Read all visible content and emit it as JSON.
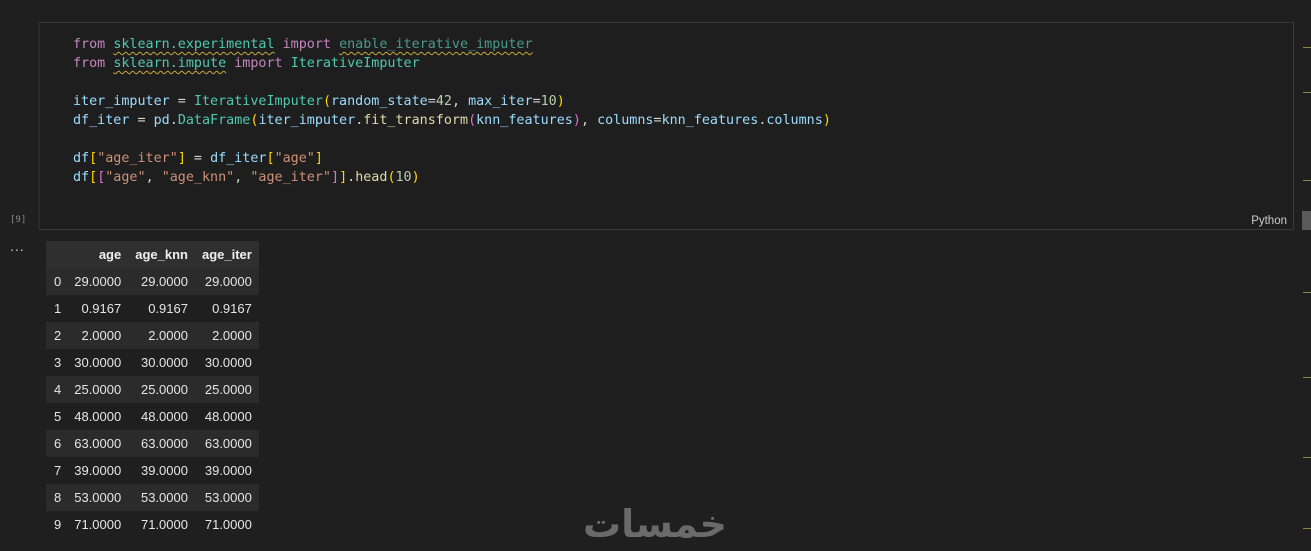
{
  "cell": {
    "execution_count": "[9]",
    "language": "Python",
    "code_lines": [
      [
        [
          "kw",
          "from"
        ],
        [
          "op",
          " "
        ],
        [
          "mod squiggle",
          "sklearn.experimental"
        ],
        [
          "op",
          " "
        ],
        [
          "kw",
          "import"
        ],
        [
          "op",
          " "
        ],
        [
          "faded squiggle",
          "enable_iterative_imputer"
        ]
      ],
      [
        [
          "kw",
          "from"
        ],
        [
          "op",
          " "
        ],
        [
          "mod squiggle",
          "sklearn.impute"
        ],
        [
          "op",
          " "
        ],
        [
          "kw",
          "import"
        ],
        [
          "op",
          " "
        ],
        [
          "mod",
          "IterativeImputer"
        ]
      ],
      [],
      [
        [
          "var",
          "iter_imputer"
        ],
        [
          "op",
          " = "
        ],
        [
          "mod",
          "IterativeImputer"
        ],
        [
          "paren1",
          "("
        ],
        [
          "var",
          "random_state"
        ],
        [
          "op",
          "="
        ],
        [
          "num",
          "42"
        ],
        [
          "op",
          ", "
        ],
        [
          "var",
          "max_iter"
        ],
        [
          "op",
          "="
        ],
        [
          "num",
          "10"
        ],
        [
          "paren1",
          ")"
        ]
      ],
      [
        [
          "var",
          "df_iter"
        ],
        [
          "op",
          " = "
        ],
        [
          "var",
          "pd"
        ],
        [
          "op",
          "."
        ],
        [
          "mod",
          "DataFrame"
        ],
        [
          "paren1",
          "("
        ],
        [
          "var",
          "iter_imputer"
        ],
        [
          "op",
          "."
        ],
        [
          "fn",
          "fit_transform"
        ],
        [
          "paren2",
          "("
        ],
        [
          "var",
          "knn_features"
        ],
        [
          "paren2",
          ")"
        ],
        [
          "op",
          ", "
        ],
        [
          "var",
          "columns"
        ],
        [
          "op",
          "="
        ],
        [
          "var",
          "knn_features"
        ],
        [
          "op",
          "."
        ],
        [
          "var",
          "columns"
        ],
        [
          "paren1",
          ")"
        ]
      ],
      [],
      [
        [
          "var",
          "df"
        ],
        [
          "paren1",
          "["
        ],
        [
          "str",
          "\"age_iter\""
        ],
        [
          "paren1",
          "]"
        ],
        [
          "op",
          " = "
        ],
        [
          "var",
          "df_iter"
        ],
        [
          "paren1",
          "["
        ],
        [
          "str",
          "\"age\""
        ],
        [
          "paren1",
          "]"
        ]
      ],
      [
        [
          "var",
          "df"
        ],
        [
          "paren1",
          "["
        ],
        [
          "paren2",
          "["
        ],
        [
          "str",
          "\"age\""
        ],
        [
          "op",
          ", "
        ],
        [
          "str",
          "\"age_knn\""
        ],
        [
          "op",
          ", "
        ],
        [
          "str",
          "\"age_iter\""
        ],
        [
          "paren2",
          "]"
        ],
        [
          "paren1",
          "]"
        ],
        [
          "op",
          "."
        ],
        [
          "fn",
          "head"
        ],
        [
          "paren1",
          "("
        ],
        [
          "num",
          "10"
        ],
        [
          "paren1",
          ")"
        ]
      ]
    ]
  },
  "output": {
    "menu_label": "...",
    "columns": [
      "",
      "age",
      "age_knn",
      "age_iter"
    ],
    "rows": [
      [
        "0",
        "29.0000",
        "29.0000",
        "29.0000"
      ],
      [
        "1",
        "0.9167",
        "0.9167",
        "0.9167"
      ],
      [
        "2",
        "2.0000",
        "2.0000",
        "2.0000"
      ],
      [
        "3",
        "30.0000",
        "30.0000",
        "30.0000"
      ],
      [
        "4",
        "25.0000",
        "25.0000",
        "25.0000"
      ],
      [
        "5",
        "48.0000",
        "48.0000",
        "48.0000"
      ],
      [
        "6",
        "63.0000",
        "63.0000",
        "63.0000"
      ],
      [
        "7",
        "39.0000",
        "39.0000",
        "39.0000"
      ],
      [
        "8",
        "53.0000",
        "53.0000",
        "53.0000"
      ],
      [
        "9",
        "71.0000",
        "71.0000",
        "71.0000"
      ]
    ]
  },
  "watermark": {
    "text": "خمسات",
    "color": "#6a6a6a"
  }
}
